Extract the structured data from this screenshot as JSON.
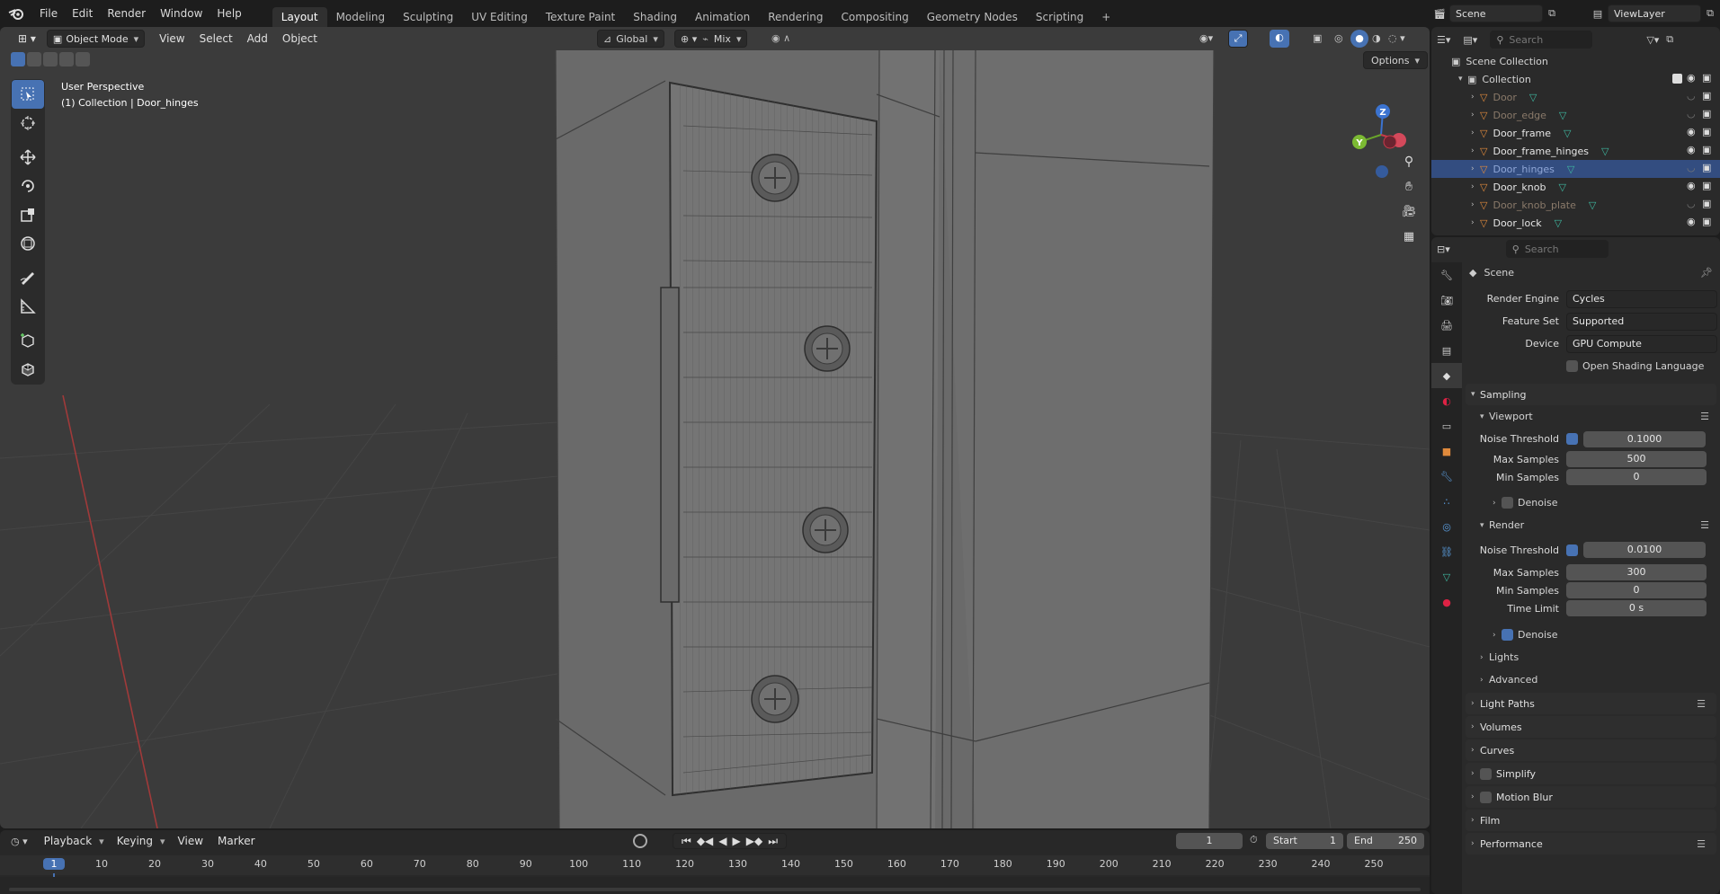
{
  "topbar": {
    "menus": [
      "File",
      "Edit",
      "Render",
      "Window",
      "Help"
    ],
    "workspaces": [
      "Layout",
      "Modeling",
      "Sculpting",
      "UV Editing",
      "Texture Paint",
      "Shading",
      "Animation",
      "Rendering",
      "Compositing",
      "Geometry Nodes",
      "Scripting"
    ],
    "active_workspace": "Layout",
    "scene": "Scene",
    "view_layer": "ViewLayer",
    "add_tab": "+"
  },
  "viewport": {
    "mode": "Object Mode",
    "menus": [
      "View",
      "Select",
      "Add",
      "Object"
    ],
    "transform_orientation": "Global",
    "pivot": "Mix",
    "options": "Options",
    "overlay_title": "User Perspective",
    "overlay_sub": "(1) Collection | Door_hinges",
    "axis_labels": {
      "z": "Z",
      "y": "Y"
    }
  },
  "toolbar": {
    "tools": [
      "select-box-icon",
      "cursor-icon",
      "move-icon",
      "rotate-icon",
      "scale-icon",
      "transform-icon",
      "annotate-icon",
      "measure-icon",
      "add-cube-icon",
      "extrude-cube-icon"
    ]
  },
  "timeline": {
    "menus": [
      "Playback",
      "Keying",
      "View",
      "Marker"
    ],
    "current_frame": "1",
    "start_label": "Start",
    "start": "1",
    "end_label": "End",
    "end": "250",
    "ticks": [
      "1",
      "10",
      "20",
      "30",
      "40",
      "50",
      "60",
      "70",
      "80",
      "90",
      "100",
      "110",
      "120",
      "130",
      "140",
      "150",
      "160",
      "170",
      "180",
      "190",
      "200",
      "210",
      "220",
      "230",
      "240",
      "250"
    ]
  },
  "outliner": {
    "search_placeholder": "Search",
    "scene_collection": "Scene Collection",
    "collection": "Collection",
    "items": [
      {
        "name": "Door",
        "dim": true,
        "selected": false
      },
      {
        "name": "Door_edge",
        "dim": true,
        "selected": false
      },
      {
        "name": "Door_frame",
        "dim": false,
        "selected": false
      },
      {
        "name": "Door_frame_hinges",
        "dim": false,
        "selected": false
      },
      {
        "name": "Door_hinges",
        "dim": true,
        "selected": true
      },
      {
        "name": "Door_knob",
        "dim": false,
        "selected": false
      },
      {
        "name": "Door_knob_plate",
        "dim": true,
        "selected": false
      },
      {
        "name": "Door_lock",
        "dim": false,
        "selected": false
      }
    ]
  },
  "properties": {
    "search_placeholder": "Search",
    "context": "Scene",
    "render_engine_label": "Render Engine",
    "render_engine": "Cycles",
    "feature_set_label": "Feature Set",
    "feature_set": "Supported",
    "device_label": "Device",
    "device": "GPU Compute",
    "osl_label": "Open Shading Language",
    "sampling": "Sampling",
    "viewport": "Viewport",
    "noise_threshold_label": "Noise Threshold",
    "vp_noise": "0.1000",
    "max_samples_label": "Max Samples",
    "vp_max": "500",
    "min_samples_label": "Min Samples",
    "vp_min": "0",
    "denoise_label": "Denoise",
    "render": "Render",
    "r_noise": "0.0100",
    "r_max": "300",
    "r_min": "0",
    "time_limit_label": "Time Limit",
    "time_limit": "0 s",
    "lights": "Lights",
    "advanced": "Advanced",
    "light_paths": "Light Paths",
    "volumes": "Volumes",
    "curves": "Curves",
    "simplify": "Simplify",
    "motion_blur": "Motion Blur",
    "film": "Film",
    "performance": "Performance"
  },
  "colors": {
    "accent": "#4772b3",
    "mesh": "#e08a3c",
    "vertex": "#3fb8a0",
    "selected_row": "#334d80"
  }
}
